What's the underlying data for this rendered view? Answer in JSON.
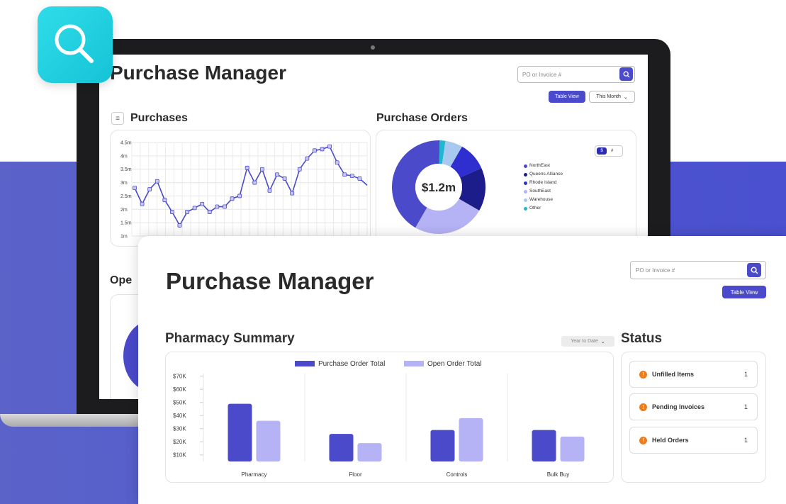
{
  "back_screen": {
    "title": "Purchase Manager",
    "search_placeholder": "PO or Invoice #",
    "table_view_label": "Table View",
    "period_label": "This Month",
    "purchases_heading": "Purchases",
    "purchase_orders_heading": "Purchase Orders",
    "open_heading": "Ope",
    "donut_center": "$1.2m",
    "toggle_left": "$",
    "toggle_right": "#",
    "legend": [
      "NorthEast",
      "Queens Alliance",
      "Rhode Island",
      "SouthEast",
      "Warehouse",
      "Other"
    ],
    "legend_colors": [
      "#4a4acb",
      "#1c1c8a",
      "#2f2fd0",
      "#b5b2f5",
      "#a9c8f0",
      "#20b8d0"
    ]
  },
  "front": {
    "title": "Purchase Manager",
    "search_placeholder": "PO or Invoice #",
    "table_view_label": "Table View",
    "summary_heading": "Pharmacy Summary",
    "period_label": "Year to Date",
    "status_heading": "Status",
    "status_items": [
      {
        "label": "Unfilled Items",
        "count": "1"
      },
      {
        "label": "Pending Invoices",
        "count": "1"
      },
      {
        "label": "Held Orders",
        "count": "1"
      }
    ]
  },
  "chart_data": [
    {
      "type": "line",
      "title": "Purchases",
      "y_ticks": [
        "4.5m",
        "4m",
        "3.5m",
        "3m",
        "2.5m",
        "2m",
        "1.5m",
        "1m"
      ],
      "ylim": [
        1,
        4.5
      ],
      "series": [
        {
          "values": [
            2.8,
            2.2,
            2.75,
            3.05,
            2.35,
            1.9,
            1.4,
            1.9,
            2.05,
            2.2,
            1.9,
            2.1,
            2.1,
            2.4,
            2.5,
            3.55,
            3.0,
            3.5,
            2.7,
            3.3,
            3.15,
            2.6,
            3.5,
            3.9,
            4.2,
            4.25,
            4.35,
            3.75,
            3.3,
            3.25,
            3.15,
            2.9
          ]
        }
      ],
      "color": "#4a4acb",
      "grid": true
    },
    {
      "type": "pie",
      "title": "Purchase Orders",
      "center_label": "$1.2m",
      "labels": [
        "NorthEast",
        "Queens Alliance",
        "Rhode Island",
        "SouthEast",
        "Warehouse",
        "Other"
      ],
      "values": [
        42,
        15,
        10,
        25,
        6,
        2
      ],
      "colors": [
        "#4a4acb",
        "#1c1c8a",
        "#2f2fd0",
        "#b5b2f5",
        "#a9c8f0",
        "#20b8d0"
      ]
    },
    {
      "type": "bar",
      "title": "Pharmacy Summary",
      "categories": [
        "Pharmacy",
        "Floor",
        "Controls",
        "Bulk Buy"
      ],
      "series": [
        {
          "name": "Purchase Order Total",
          "values": [
            49,
            26,
            29,
            29
          ],
          "color": "#4a4acb"
        },
        {
          "name": "Open Order Total",
          "values": [
            36,
            19,
            38,
            24
          ],
          "color": "#b5b2f5"
        }
      ],
      "y_ticks": [
        "$70K",
        "$60K",
        "$50K",
        "$40K",
        "$30K",
        "$20K",
        "$10K"
      ],
      "ylim": [
        5,
        72
      ],
      "legend_position": "top-center"
    }
  ]
}
